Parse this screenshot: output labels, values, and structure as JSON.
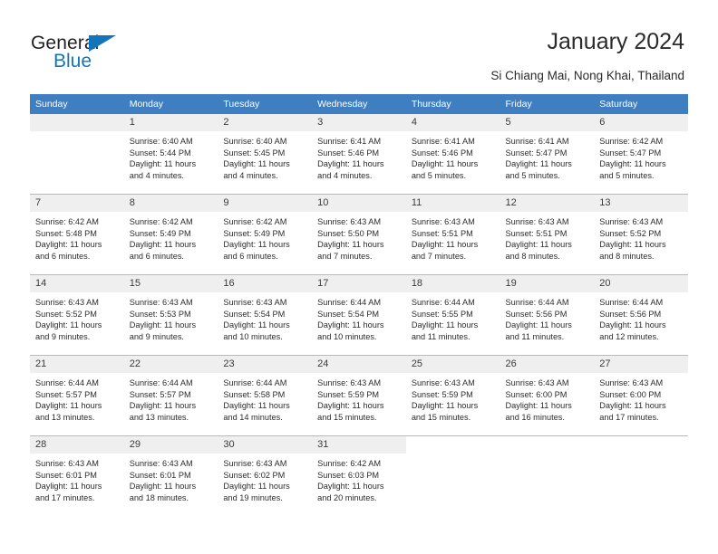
{
  "brand": {
    "name_top": "General",
    "name_bottom": "Blue",
    "accent_color": "#1275bc",
    "triangle_icon": "triangle-icon"
  },
  "header": {
    "title": "January 2024",
    "subtitle": "Si Chiang Mai, Nong Khai, Thailand"
  },
  "calendar": {
    "header_color": "#3f7fc1",
    "weekday_headers": [
      "Sunday",
      "Monday",
      "Tuesday",
      "Wednesday",
      "Thursday",
      "Friday",
      "Saturday"
    ],
    "weeks": [
      [
        {
          "day": "",
          "lines": []
        },
        {
          "day": "1",
          "lines": [
            "Sunrise: 6:40 AM",
            "Sunset: 5:44 PM",
            "Daylight: 11 hours",
            "and 4 minutes."
          ]
        },
        {
          "day": "2",
          "lines": [
            "Sunrise: 6:40 AM",
            "Sunset: 5:45 PM",
            "Daylight: 11 hours",
            "and 4 minutes."
          ]
        },
        {
          "day": "3",
          "lines": [
            "Sunrise: 6:41 AM",
            "Sunset: 5:46 PM",
            "Daylight: 11 hours",
            "and 4 minutes."
          ]
        },
        {
          "day": "4",
          "lines": [
            "Sunrise: 6:41 AM",
            "Sunset: 5:46 PM",
            "Daylight: 11 hours",
            "and 5 minutes."
          ]
        },
        {
          "day": "5",
          "lines": [
            "Sunrise: 6:41 AM",
            "Sunset: 5:47 PM",
            "Daylight: 11 hours",
            "and 5 minutes."
          ]
        },
        {
          "day": "6",
          "lines": [
            "Sunrise: 6:42 AM",
            "Sunset: 5:47 PM",
            "Daylight: 11 hours",
            "and 5 minutes."
          ]
        }
      ],
      [
        {
          "day": "7",
          "lines": [
            "Sunrise: 6:42 AM",
            "Sunset: 5:48 PM",
            "Daylight: 11 hours",
            "and 6 minutes."
          ]
        },
        {
          "day": "8",
          "lines": [
            "Sunrise: 6:42 AM",
            "Sunset: 5:49 PM",
            "Daylight: 11 hours",
            "and 6 minutes."
          ]
        },
        {
          "day": "9",
          "lines": [
            "Sunrise: 6:42 AM",
            "Sunset: 5:49 PM",
            "Daylight: 11 hours",
            "and 6 minutes."
          ]
        },
        {
          "day": "10",
          "lines": [
            "Sunrise: 6:43 AM",
            "Sunset: 5:50 PM",
            "Daylight: 11 hours",
            "and 7 minutes."
          ]
        },
        {
          "day": "11",
          "lines": [
            "Sunrise: 6:43 AM",
            "Sunset: 5:51 PM",
            "Daylight: 11 hours",
            "and 7 minutes."
          ]
        },
        {
          "day": "12",
          "lines": [
            "Sunrise: 6:43 AM",
            "Sunset: 5:51 PM",
            "Daylight: 11 hours",
            "and 8 minutes."
          ]
        },
        {
          "day": "13",
          "lines": [
            "Sunrise: 6:43 AM",
            "Sunset: 5:52 PM",
            "Daylight: 11 hours",
            "and 8 minutes."
          ]
        }
      ],
      [
        {
          "day": "14",
          "lines": [
            "Sunrise: 6:43 AM",
            "Sunset: 5:52 PM",
            "Daylight: 11 hours",
            "and 9 minutes."
          ]
        },
        {
          "day": "15",
          "lines": [
            "Sunrise: 6:43 AM",
            "Sunset: 5:53 PM",
            "Daylight: 11 hours",
            "and 9 minutes."
          ]
        },
        {
          "day": "16",
          "lines": [
            "Sunrise: 6:43 AM",
            "Sunset: 5:54 PM",
            "Daylight: 11 hours",
            "and 10 minutes."
          ]
        },
        {
          "day": "17",
          "lines": [
            "Sunrise: 6:44 AM",
            "Sunset: 5:54 PM",
            "Daylight: 11 hours",
            "and 10 minutes."
          ]
        },
        {
          "day": "18",
          "lines": [
            "Sunrise: 6:44 AM",
            "Sunset: 5:55 PM",
            "Daylight: 11 hours",
            "and 11 minutes."
          ]
        },
        {
          "day": "19",
          "lines": [
            "Sunrise: 6:44 AM",
            "Sunset: 5:56 PM",
            "Daylight: 11 hours",
            "and 11 minutes."
          ]
        },
        {
          "day": "20",
          "lines": [
            "Sunrise: 6:44 AM",
            "Sunset: 5:56 PM",
            "Daylight: 11 hours",
            "and 12 minutes."
          ]
        }
      ],
      [
        {
          "day": "21",
          "lines": [
            "Sunrise: 6:44 AM",
            "Sunset: 5:57 PM",
            "Daylight: 11 hours",
            "and 13 minutes."
          ]
        },
        {
          "day": "22",
          "lines": [
            "Sunrise: 6:44 AM",
            "Sunset: 5:57 PM",
            "Daylight: 11 hours",
            "and 13 minutes."
          ]
        },
        {
          "day": "23",
          "lines": [
            "Sunrise: 6:44 AM",
            "Sunset: 5:58 PM",
            "Daylight: 11 hours",
            "and 14 minutes."
          ]
        },
        {
          "day": "24",
          "lines": [
            "Sunrise: 6:43 AM",
            "Sunset: 5:59 PM",
            "Daylight: 11 hours",
            "and 15 minutes."
          ]
        },
        {
          "day": "25",
          "lines": [
            "Sunrise: 6:43 AM",
            "Sunset: 5:59 PM",
            "Daylight: 11 hours",
            "and 15 minutes."
          ]
        },
        {
          "day": "26",
          "lines": [
            "Sunrise: 6:43 AM",
            "Sunset: 6:00 PM",
            "Daylight: 11 hours",
            "and 16 minutes."
          ]
        },
        {
          "day": "27",
          "lines": [
            "Sunrise: 6:43 AM",
            "Sunset: 6:00 PM",
            "Daylight: 11 hours",
            "and 17 minutes."
          ]
        }
      ],
      [
        {
          "day": "28",
          "lines": [
            "Sunrise: 6:43 AM",
            "Sunset: 6:01 PM",
            "Daylight: 11 hours",
            "and 17 minutes."
          ]
        },
        {
          "day": "29",
          "lines": [
            "Sunrise: 6:43 AM",
            "Sunset: 6:01 PM",
            "Daylight: 11 hours",
            "and 18 minutes."
          ]
        },
        {
          "day": "30",
          "lines": [
            "Sunrise: 6:43 AM",
            "Sunset: 6:02 PM",
            "Daylight: 11 hours",
            "and 19 minutes."
          ]
        },
        {
          "day": "31",
          "lines": [
            "Sunrise: 6:42 AM",
            "Sunset: 6:03 PM",
            "Daylight: 11 hours",
            "and 20 minutes."
          ]
        },
        {
          "day": "",
          "lines": []
        },
        {
          "day": "",
          "lines": []
        },
        {
          "day": "",
          "lines": []
        }
      ]
    ]
  }
}
